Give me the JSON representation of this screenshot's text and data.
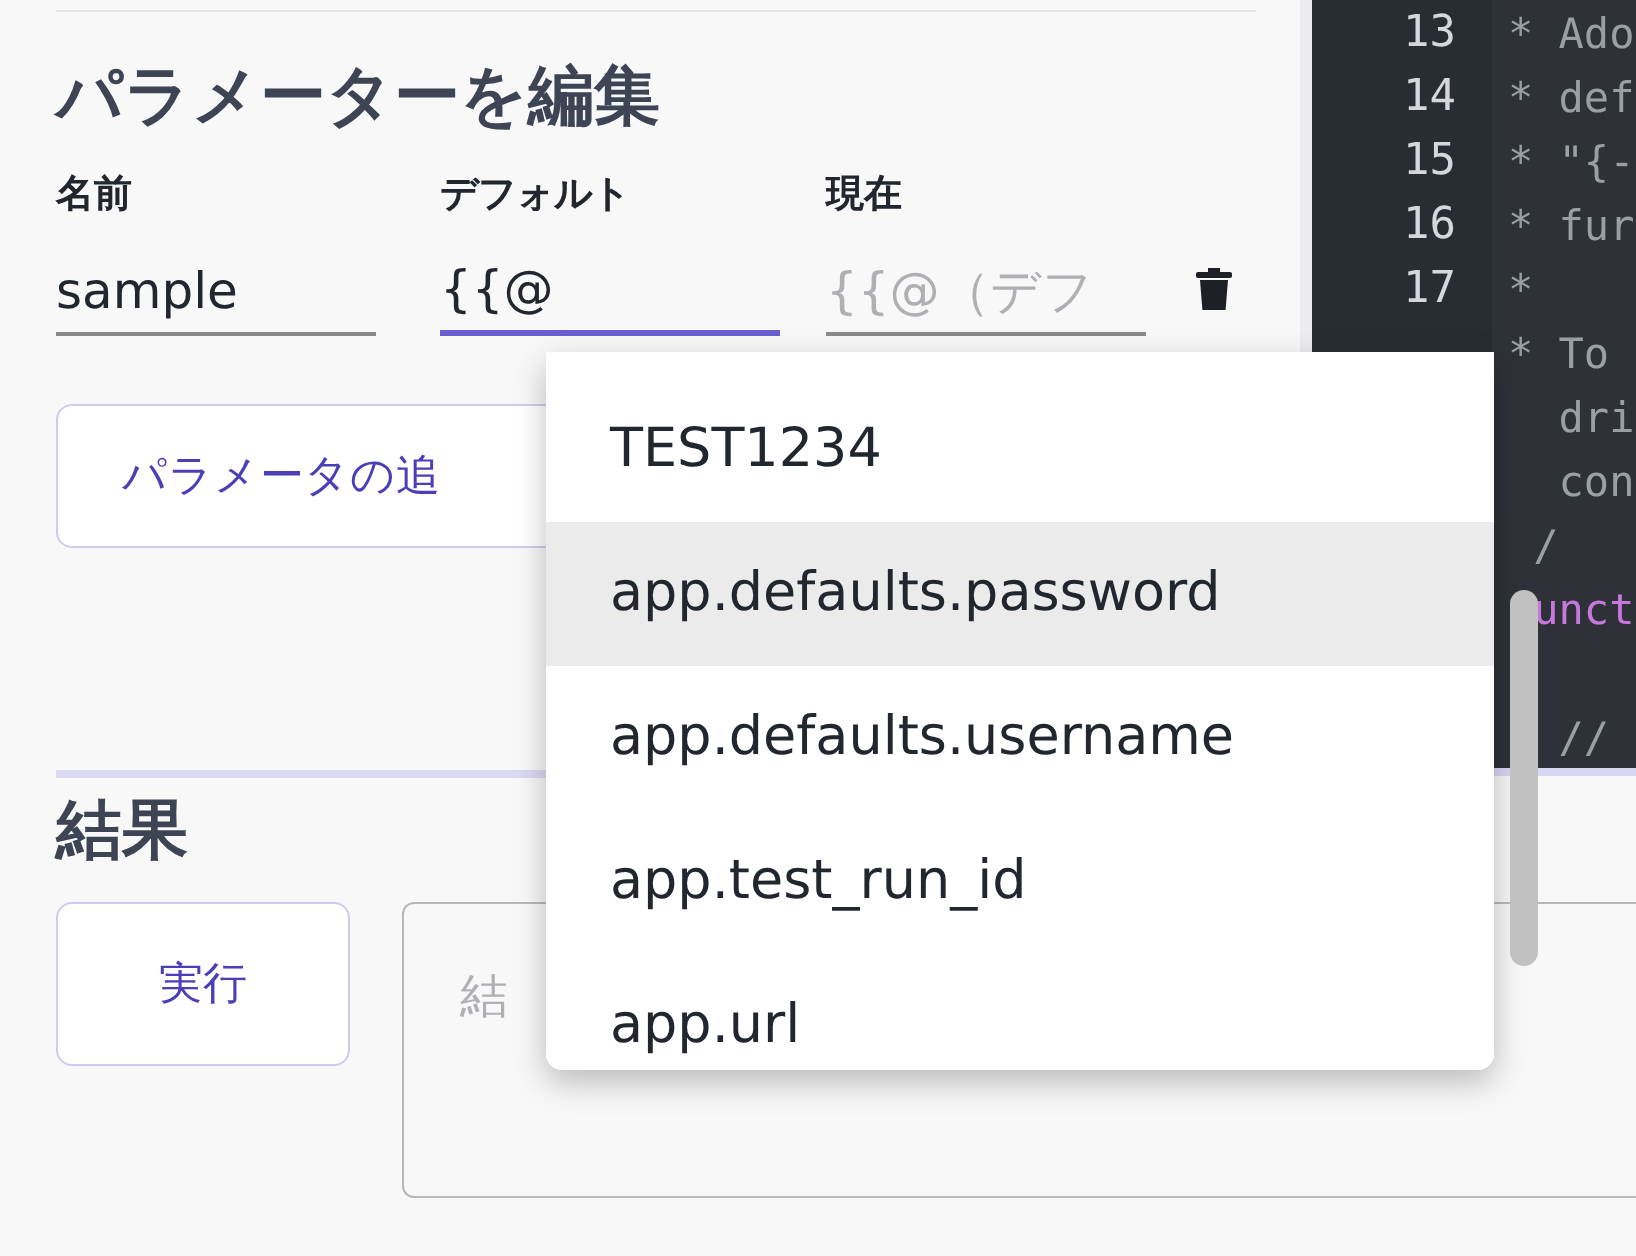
{
  "editor": {
    "heading": "パラメーターを編集",
    "columns": [
      "名前",
      "デフォルト",
      "現在"
    ],
    "parameter": {
      "name": "sample",
      "default": "{{@",
      "current_placeholder": "{{@（デフ"
    },
    "add_button": "パラメータの追"
  },
  "code_editor": {
    "lines": [
      {
        "number": "13",
        "text": "* Ado",
        "kind": "comment"
      },
      {
        "number": "14",
        "text": "* def",
        "kind": "comment"
      },
      {
        "number": "15",
        "text": "* \"{-",
        "kind": "comment"
      },
      {
        "number": "16",
        "text": "* fur",
        "kind": "comment"
      },
      {
        "number": "17",
        "text": "*",
        "kind": "comment"
      },
      {
        "text": "* To",
        "kind": "comment"
      },
      {
        "text": "  dri",
        "kind": "comment"
      },
      {
        "text": "  con",
        "kind": "comment"
      },
      {
        "text": " /",
        "kind": "comment"
      },
      {
        "text": " unct",
        "kind": "keyword"
      },
      {
        "kind": "blank"
      },
      {
        "text": "  //",
        "kind": "comment"
      }
    ]
  },
  "autocomplete": {
    "items": [
      {
        "label": "TEST1234",
        "selected": false
      },
      {
        "label": "app.defaults.password",
        "selected": true
      },
      {
        "label": "app.defaults.username",
        "selected": false
      },
      {
        "label": "app.test_run_id",
        "selected": false
      },
      {
        "label": "app.url",
        "selected": false
      }
    ]
  },
  "result": {
    "heading": "結果",
    "run_button": "実行",
    "output_placeholder": "結"
  }
}
